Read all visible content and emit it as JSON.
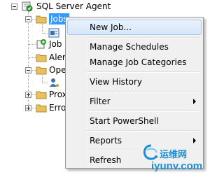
{
  "tree": {
    "root": {
      "label": "SQL Server Agent"
    },
    "items": [
      {
        "label": "Jobs"
      },
      {
        "label": ""
      },
      {
        "label": "Job"
      },
      {
        "label": "Aler"
      },
      {
        "label": "Ope"
      },
      {
        "label": ""
      },
      {
        "label": "Prox"
      },
      {
        "label": "Erro"
      }
    ]
  },
  "context_menu": {
    "items": [
      {
        "label": "New Job...",
        "highlighted": true
      },
      {
        "label": "Manage Schedules"
      },
      {
        "label": "Manage Job Categories"
      },
      {
        "label": "View History"
      },
      {
        "label": "Filter",
        "submenu": true
      },
      {
        "label": "Start PowerShell"
      },
      {
        "label": "Reports",
        "submenu": true
      },
      {
        "label": "Refresh"
      }
    ]
  },
  "watermark": {
    "cn_text": "运维网",
    "url_text": "iyunv.com"
  },
  "colors": {
    "selection": "#3399ff",
    "menu_background": "#f0f0f0",
    "menu_hover": "#d6e6fa",
    "folder": "#e8c060",
    "watermark": "#1a8fd8"
  }
}
